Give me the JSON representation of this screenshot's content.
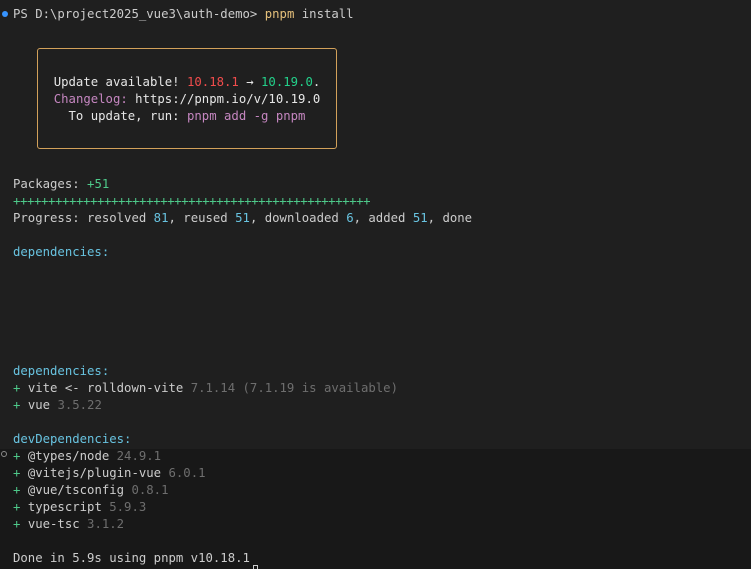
{
  "prompt": {
    "ps": "PS ",
    "path": "D:\\project2025_vue3\\auth-demo> ",
    "cmd": "pnpm",
    "args": " install"
  },
  "update_box": {
    "l1_text": "Update available! ",
    "l1_old": "10.18.1",
    "l1_arrow": " → ",
    "l1_new": "10.19.0",
    "l1_end": ".",
    "l2_label": "Changelog: ",
    "l2_url": "https://pnpm.io/v/10.19.0",
    "l3_text": "To update, run: ",
    "l3_cmd": "pnpm add -g pnpm"
  },
  "packages": {
    "label": "Packages: ",
    "count": "+51"
  },
  "progress_bar": "+++++++++++++++++++++++++++++++++++++++++++++++++++",
  "progress": {
    "p1": "Progress: resolved ",
    "resolved": "81",
    "p2": ", reused ",
    "reused": "51",
    "p3": ", downloaded ",
    "downloaded": "6",
    "p4": ", added ",
    "added": "51",
    "p5": ", done"
  },
  "dependencies_header": "dependencies:",
  "deps": [
    {
      "plus": "+ ",
      "name": "vite <- rolldown-vite ",
      "version": "7.1.14 (7.1.19 is available)"
    },
    {
      "plus": "+ ",
      "name": "vue ",
      "version": "3.5.22"
    }
  ],
  "dev_dependencies_header": "devDependencies:",
  "dev_deps": [
    {
      "plus": "+ ",
      "name": "@types/node ",
      "version": "24.9.1"
    },
    {
      "plus": "+ ",
      "name": "@vitejs/plugin-vue ",
      "version": "6.0.1"
    },
    {
      "plus": "+ ",
      "name": "@vue/tsconfig ",
      "version": "0.8.1"
    },
    {
      "plus": "+ ",
      "name": "typescript ",
      "version": "5.9.3"
    },
    {
      "plus": "+ ",
      "name": "vue-tsc ",
      "version": "3.1.2"
    }
  ],
  "done": "Done in 5.9s using pnpm v10.18.1"
}
